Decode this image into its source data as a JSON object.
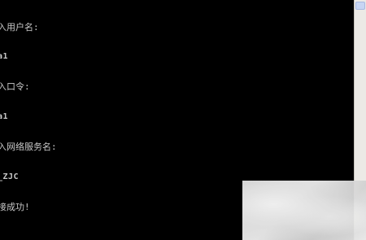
{
  "console": {
    "lines": [
      "入用户名:",
      "a1",
      "入口令:",
      "a1",
      "入网络服务名:",
      "_ZJC",
      "接成功!"
    ]
  }
}
